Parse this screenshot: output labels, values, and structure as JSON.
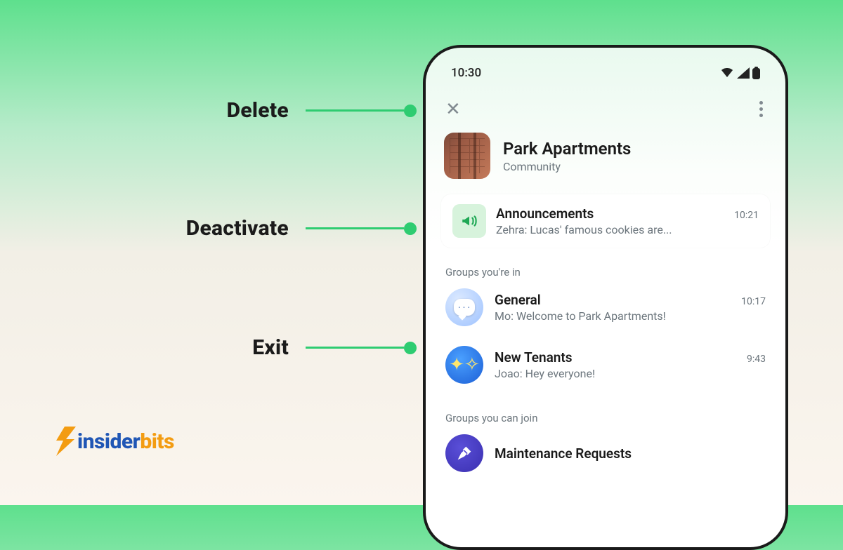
{
  "leftActions": {
    "delete": "Delete",
    "deactivate": "Deactivate",
    "exit": "Exit"
  },
  "logo": {
    "part1": "insider",
    "part2": "bits"
  },
  "phone": {
    "statusTime": "10:30",
    "community": {
      "name": "Park Apartments",
      "subtitle": "Community"
    },
    "announcements": {
      "title": "Announcements",
      "time": "10:21",
      "preview": "Zehra: Lucas' famous cookies are..."
    },
    "sectionIn": "Groups you're in",
    "groups": [
      {
        "title": "General",
        "time": "10:17",
        "preview": "Mo: Welcome to Park Apartments!"
      },
      {
        "title": "New Tenants",
        "time": "9:43",
        "preview": "Joao: Hey everyone!"
      }
    ],
    "sectionJoin": "Groups you can join",
    "joinable": [
      {
        "title": "Maintenance Requests"
      }
    ]
  }
}
